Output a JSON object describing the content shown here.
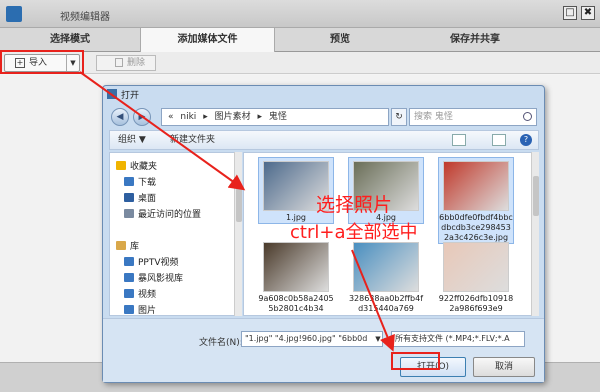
{
  "app": {
    "title": "视频编辑器",
    "btn_min": "□",
    "btn_close": "✖"
  },
  "tabs": [
    {
      "label": "选择模式"
    },
    {
      "label": "添加媒体文件"
    },
    {
      "label": "预览"
    },
    {
      "label": "保存并共享"
    }
  ],
  "toolbar": {
    "import_label": "导入",
    "import_icon": "+",
    "drop_arrow": "▼",
    "delete_label": "删除"
  },
  "dialog": {
    "title": "打开",
    "nav_back": "◀",
    "nav_forward": "▶",
    "breadcrumb": [
      "«",
      "niki",
      "▸",
      "图片素材",
      "▸",
      "鬼怪"
    ],
    "refresh": "↻",
    "search_placeholder": "搜索 鬼怪",
    "organize": "组织 ▼",
    "new_folder": "新建文件夹",
    "help": "?",
    "nav_items": [
      {
        "label": "收藏夹",
        "icon": "star-icon",
        "color": "#f0b400"
      },
      {
        "label": "下载",
        "icon": "download-folder-icon",
        "color": "#3a78c2"
      },
      {
        "label": "桌面",
        "icon": "desktop-icon",
        "color": "#2e5fa0"
      },
      {
        "label": "最近访问的位置",
        "icon": "recent-places-icon",
        "color": "#7a8aa0"
      },
      {
        "label": "库",
        "icon": "library-icon",
        "color": "#d9a84a"
      },
      {
        "label": "PPTV视频",
        "icon": "video-folder-icon",
        "color": "#3a78c2"
      },
      {
        "label": "暴风影视库",
        "icon": "video-folder-icon",
        "color": "#3a78c2"
      },
      {
        "label": "视频",
        "icon": "video-folder-icon",
        "color": "#3a78c2"
      },
      {
        "label": "图片",
        "icon": "pictures-folder-icon",
        "color": "#3a78c2"
      }
    ],
    "files": [
      {
        "name": "1.jpg",
        "color": "#4d6a8c",
        "selected": true
      },
      {
        "name": "4.jpg",
        "color": "#6a6e58",
        "selected": true
      },
      {
        "name": "6bb0dfe0fbdf4bbcdbcdb3ce2984532a3c426c3e.jpg",
        "color": "#c0392b",
        "selected": true
      },
      {
        "name": "9a608c0b58a24055b2801c4b34",
        "color": "#4a3a2a",
        "selected": false
      },
      {
        "name": "328638aa0b2ffb4fd315440a769",
        "color": "#4a8fc0",
        "selected": false
      },
      {
        "name": "922ff026dfb109182a986f693e9",
        "color": "#e8c8b8",
        "selected": false
      }
    ],
    "filename_label": "文件名(N):",
    "filename_value": "\"1.jpg\" \"4.jpg!960.jpg\" \"6bb0d",
    "filetype_value": "所有支持文件 (*.MP4;*.FLV;*.A",
    "open_label": "打开(O)",
    "cancel_label": "取消"
  },
  "annotations": {
    "line1": "选择照片",
    "line2": "ctrl+a全部选中",
    "color": "#ff1e1e"
  }
}
